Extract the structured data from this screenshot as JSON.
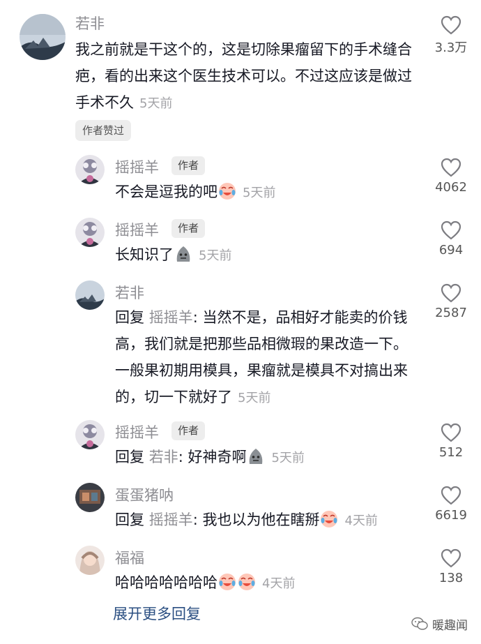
{
  "comments": [
    {
      "user": "若非",
      "text": "我之前就是干这个的，这是切除果瘤留下的手术缝合疤，看的出来这个医生技术可以。不过这应该是做过手术不久",
      "time": "5天前",
      "likes": "3.3万"
    },
    {
      "user": "摇摇羊",
      "badge": "作者",
      "text": "不会是逗我的吧",
      "emoji": "crying-laugh-face",
      "time": "5天前",
      "likes": "4062"
    },
    {
      "user": "摇摇羊",
      "badge": "作者",
      "text": "长知识了",
      "emoji": "gray-stone-face",
      "time": "5天前",
      "likes": "694"
    },
    {
      "user": "若非",
      "reply_label": "回复",
      "reply_to": "摇摇羊",
      "text": "当然不是，品相好才能卖的价钱高，我们就是把那些品相微瑕的果改造一下。一般果初期用模具，果瘤就是模具不对搞出来的，切一下就好了",
      "time": "5天前",
      "likes": "2587"
    },
    {
      "user": "摇摇羊",
      "badge": "作者",
      "reply_label": "回复",
      "reply_to": "若非",
      "text": "好神奇啊",
      "emoji": "gray-stone-face",
      "time": "5天前",
      "likes": "512"
    },
    {
      "user": "蛋蛋猪呐",
      "reply_label": "回复",
      "reply_to": "摇摇羊",
      "text": "我也以为他在瞎掰",
      "emoji": "crying-laugh-face",
      "time": "4天前",
      "likes": "6619"
    },
    {
      "user": "福福",
      "text": "哈哈哈哈哈哈哈",
      "emoji": "crying-laugh-face x2",
      "time": "4天前",
      "likes": "138"
    }
  ],
  "author_liked_tag": "作者赞过",
  "expand_more": "展开更多回复",
  "watermark": "暖趣闻",
  "reply_colon": ":",
  "colors": {
    "name": "#8e8e93",
    "text": "#161823",
    "time": "#a3a3a7",
    "expand_link": "#2b4f82",
    "badge_bg": "#ededed"
  }
}
